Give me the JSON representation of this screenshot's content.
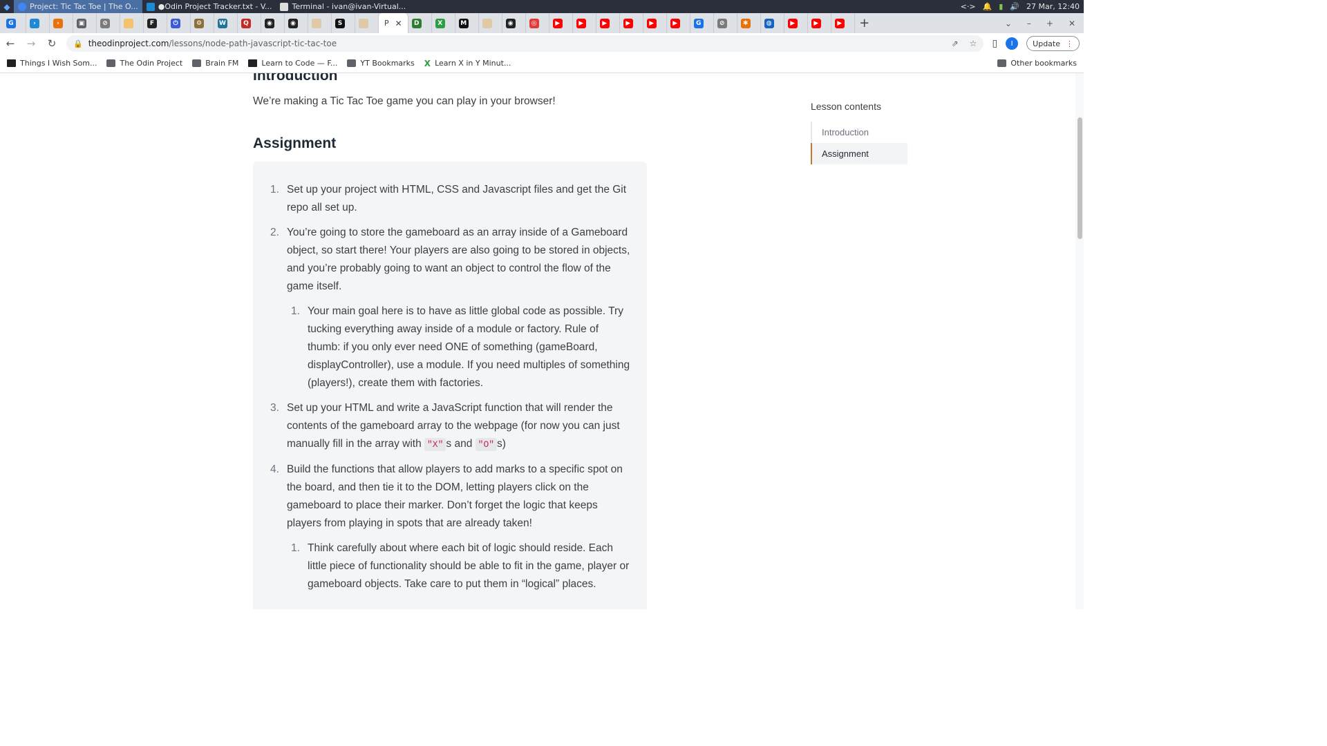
{
  "taskbar": {
    "tasks": [
      {
        "label": "Project: Tic Tac Toe | The O...",
        "active": true
      },
      {
        "label": "●Odin Project Tracker.txt - V...",
        "active": false
      },
      {
        "label": "Terminal - ivan@ivan-Virtual...",
        "active": false
      }
    ],
    "date": "27 Mar, 12:40"
  },
  "browser": {
    "active_tab_letter": "P",
    "url_host": "theodinproject.com",
    "url_path": "/lessons/node-path-javascript-tic-tac-toe",
    "update_label": "Update",
    "profile_initial": "I"
  },
  "bookmarks": [
    {
      "label": "Things I Wish Som...",
      "icon": "dark"
    },
    {
      "label": "The Odin Project",
      "icon": "folder"
    },
    {
      "label": "Brain FM",
      "icon": "folder"
    },
    {
      "label": "Learn to Code — F...",
      "icon": "dark"
    },
    {
      "label": "YT Bookmarks",
      "icon": "folder"
    },
    {
      "label": "Learn X in Y Minut...",
      "icon": "green"
    }
  ],
  "other_bookmarks": "Other bookmarks",
  "article": {
    "intro_heading": "Introduction",
    "intro_text": "We’re making a Tic Tac Toe game you can play in your browser!",
    "assignment_heading": "Assignment",
    "steps": [
      {
        "num": "1.",
        "text": "Set up your project with HTML, CSS and Javascript files and get the Git repo all set up."
      },
      {
        "num": "2.",
        "text": "You’re going to store the gameboard as an array inside of a Gameboard object, so start there! Your players are also going to be stored in objects, and you’re probably going to want an object to control the flow of the game itself."
      },
      {
        "num": "3.",
        "text_a": "Set up your HTML and write a JavaScript function that will render the contents of the gameboard array to the webpage (for now you can just manually fill in the array with ",
        "code_x": "\"X\"",
        "text_b": "s and ",
        "code_o": "\"O\"",
        "text_c": "s)"
      },
      {
        "num": "4.",
        "text": "Build the functions that allow players to add marks to a specific spot on the board, and then tie it to the DOM, letting players click on the gameboard to place their marker. Don’t forget the logic that keeps players from playing in spots that are already taken!"
      }
    ],
    "substep_2": {
      "num": "1.",
      "text": "Your main goal here is to have as little global code as possible. Try tucking everything away inside of a module or factory. Rule of thumb: if you only ever need ONE of something (gameBoard, displayController), use a module. If you need multiples of something (players!), create them with factories."
    },
    "substep_4": {
      "num": "1.",
      "text": "Think carefully about where each bit of logic should reside. Each little piece of functionality should be able to fit in the game, player or gameboard objects. Take care to put them in “logical” places."
    }
  },
  "toc": {
    "title": "Lesson contents",
    "items": [
      "Introduction",
      "Assignment"
    ],
    "active": "Assignment"
  }
}
